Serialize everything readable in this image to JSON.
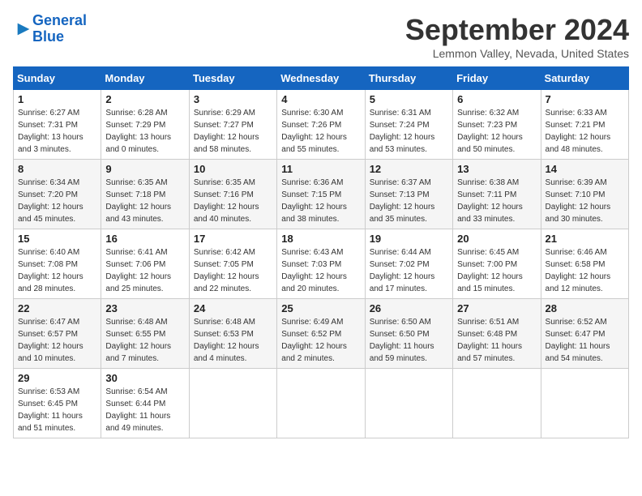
{
  "logo": {
    "line1": "General",
    "line2": "Blue"
  },
  "header": {
    "month": "September 2024",
    "location": "Lemmon Valley, Nevada, United States"
  },
  "columns": [
    "Sunday",
    "Monday",
    "Tuesday",
    "Wednesday",
    "Thursday",
    "Friday",
    "Saturday"
  ],
  "weeks": [
    [
      {
        "day": "1",
        "sunrise": "6:27 AM",
        "sunset": "7:31 PM",
        "daylight": "13 hours and 3 minutes."
      },
      {
        "day": "2",
        "sunrise": "6:28 AM",
        "sunset": "7:29 PM",
        "daylight": "13 hours and 0 minutes."
      },
      {
        "day": "3",
        "sunrise": "6:29 AM",
        "sunset": "7:27 PM",
        "daylight": "12 hours and 58 minutes."
      },
      {
        "day": "4",
        "sunrise": "6:30 AM",
        "sunset": "7:26 PM",
        "daylight": "12 hours and 55 minutes."
      },
      {
        "day": "5",
        "sunrise": "6:31 AM",
        "sunset": "7:24 PM",
        "daylight": "12 hours and 53 minutes."
      },
      {
        "day": "6",
        "sunrise": "6:32 AM",
        "sunset": "7:23 PM",
        "daylight": "12 hours and 50 minutes."
      },
      {
        "day": "7",
        "sunrise": "6:33 AM",
        "sunset": "7:21 PM",
        "daylight": "12 hours and 48 minutes."
      }
    ],
    [
      {
        "day": "8",
        "sunrise": "6:34 AM",
        "sunset": "7:20 PM",
        "daylight": "12 hours and 45 minutes."
      },
      {
        "day": "9",
        "sunrise": "6:35 AM",
        "sunset": "7:18 PM",
        "daylight": "12 hours and 43 minutes."
      },
      {
        "day": "10",
        "sunrise": "6:35 AM",
        "sunset": "7:16 PM",
        "daylight": "12 hours and 40 minutes."
      },
      {
        "day": "11",
        "sunrise": "6:36 AM",
        "sunset": "7:15 PM",
        "daylight": "12 hours and 38 minutes."
      },
      {
        "day": "12",
        "sunrise": "6:37 AM",
        "sunset": "7:13 PM",
        "daylight": "12 hours and 35 minutes."
      },
      {
        "day": "13",
        "sunrise": "6:38 AM",
        "sunset": "7:11 PM",
        "daylight": "12 hours and 33 minutes."
      },
      {
        "day": "14",
        "sunrise": "6:39 AM",
        "sunset": "7:10 PM",
        "daylight": "12 hours and 30 minutes."
      }
    ],
    [
      {
        "day": "15",
        "sunrise": "6:40 AM",
        "sunset": "7:08 PM",
        "daylight": "12 hours and 28 minutes."
      },
      {
        "day": "16",
        "sunrise": "6:41 AM",
        "sunset": "7:06 PM",
        "daylight": "12 hours and 25 minutes."
      },
      {
        "day": "17",
        "sunrise": "6:42 AM",
        "sunset": "7:05 PM",
        "daylight": "12 hours and 22 minutes."
      },
      {
        "day": "18",
        "sunrise": "6:43 AM",
        "sunset": "7:03 PM",
        "daylight": "12 hours and 20 minutes."
      },
      {
        "day": "19",
        "sunrise": "6:44 AM",
        "sunset": "7:02 PM",
        "daylight": "12 hours and 17 minutes."
      },
      {
        "day": "20",
        "sunrise": "6:45 AM",
        "sunset": "7:00 PM",
        "daylight": "12 hours and 15 minutes."
      },
      {
        "day": "21",
        "sunrise": "6:46 AM",
        "sunset": "6:58 PM",
        "daylight": "12 hours and 12 minutes."
      }
    ],
    [
      {
        "day": "22",
        "sunrise": "6:47 AM",
        "sunset": "6:57 PM",
        "daylight": "12 hours and 10 minutes."
      },
      {
        "day": "23",
        "sunrise": "6:48 AM",
        "sunset": "6:55 PM",
        "daylight": "12 hours and 7 minutes."
      },
      {
        "day": "24",
        "sunrise": "6:48 AM",
        "sunset": "6:53 PM",
        "daylight": "12 hours and 4 minutes."
      },
      {
        "day": "25",
        "sunrise": "6:49 AM",
        "sunset": "6:52 PM",
        "daylight": "12 hours and 2 minutes."
      },
      {
        "day": "26",
        "sunrise": "6:50 AM",
        "sunset": "6:50 PM",
        "daylight": "11 hours and 59 minutes."
      },
      {
        "day": "27",
        "sunrise": "6:51 AM",
        "sunset": "6:48 PM",
        "daylight": "11 hours and 57 minutes."
      },
      {
        "day": "28",
        "sunrise": "6:52 AM",
        "sunset": "6:47 PM",
        "daylight": "11 hours and 54 minutes."
      }
    ],
    [
      {
        "day": "29",
        "sunrise": "6:53 AM",
        "sunset": "6:45 PM",
        "daylight": "11 hours and 51 minutes."
      },
      {
        "day": "30",
        "sunrise": "6:54 AM",
        "sunset": "6:44 PM",
        "daylight": "11 hours and 49 minutes."
      },
      null,
      null,
      null,
      null,
      null
    ]
  ]
}
